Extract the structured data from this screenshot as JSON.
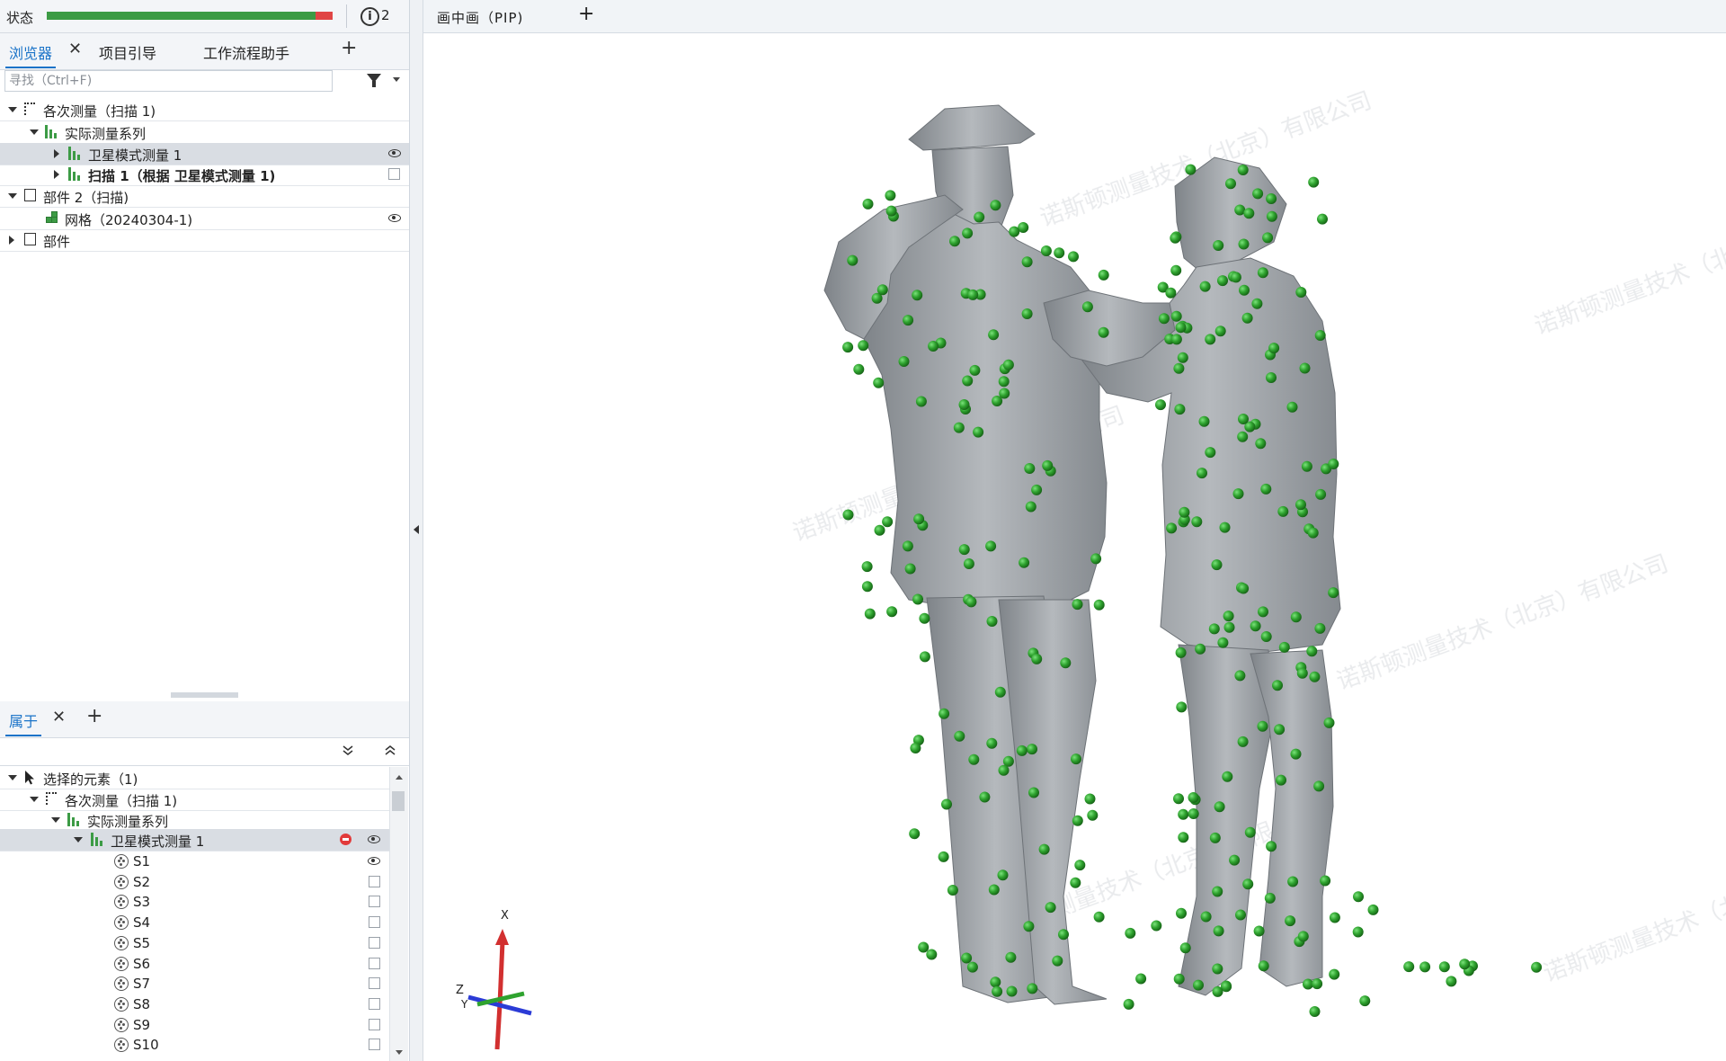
{
  "status_bar": {
    "label": "状态",
    "progress_fraction": 0.94,
    "info_count": "2",
    "info_icon": "info-icon"
  },
  "browser_tabs": [
    {
      "label": "浏览器",
      "active": true,
      "closable": true
    },
    {
      "label": "项目引导",
      "active": false
    },
    {
      "label": "工作流程助手",
      "active": false
    }
  ],
  "add_tab_label": "+",
  "close_label": "✕",
  "search": {
    "placeholder": "寻找（Ctrl+F)"
  },
  "tree": [
    {
      "label": "各次测量（扫描 1)",
      "icon": "measurement-bracket-icon",
      "expanded": true
    },
    {
      "label": "实际测量系列",
      "icon": "series-icon",
      "expanded": true
    },
    {
      "label": "卫星模式测量 1",
      "icon": "series-icon",
      "expanded": false,
      "selected": true,
      "visible": true
    },
    {
      "label": "扫描 1（根据 卫星模式测量 1)",
      "icon": "series-icon",
      "expanded": false,
      "bold": true,
      "visible": false
    },
    {
      "label": "部件 2（扫描)",
      "icon": "part-icon",
      "expanded": true
    },
    {
      "label": "网格（20240304-1)",
      "icon": "mesh-icon",
      "visible": true
    },
    {
      "label": "部件",
      "icon": "part-icon",
      "expanded": false
    }
  ],
  "properties_tab": {
    "label": "属于"
  },
  "props_tree": [
    {
      "label": "选择的元素（1)",
      "icon": "cursor-icon",
      "expanded": true
    },
    {
      "label": "各次测量（扫描 1)",
      "icon": "measurement-bracket-icon",
      "expanded": true
    },
    {
      "label": "实际测量系列",
      "icon": "series-icon",
      "expanded": true
    },
    {
      "label": "卫星模式测量 1",
      "icon": "series-icon",
      "expanded": true,
      "selected": true,
      "error": true,
      "visible": true
    }
  ],
  "points": [
    {
      "label": "S1",
      "visible": true
    },
    {
      "label": "S2",
      "visible": false
    },
    {
      "label": "S3",
      "visible": false
    },
    {
      "label": "S4",
      "visible": false
    },
    {
      "label": "S5",
      "visible": false
    },
    {
      "label": "S6",
      "visible": false
    },
    {
      "label": "S7",
      "visible": false
    },
    {
      "label": "S8",
      "visible": false
    },
    {
      "label": "S9",
      "visible": false
    },
    {
      "label": "S10",
      "visible": false
    }
  ],
  "viewport": {
    "tab_label": "画中画（PIP)",
    "watermark": "诺斯顿测量技术（北京）有限公司",
    "axis_labels": {
      "x": "X",
      "y": "Y",
      "z": "Z"
    },
    "colors": {
      "mesh": "#9a9ea3",
      "marker": "#2fa32f",
      "x_axis": "#d23030",
      "y_axis": "#2fa32f",
      "z_axis": "#2b3bd6"
    }
  }
}
